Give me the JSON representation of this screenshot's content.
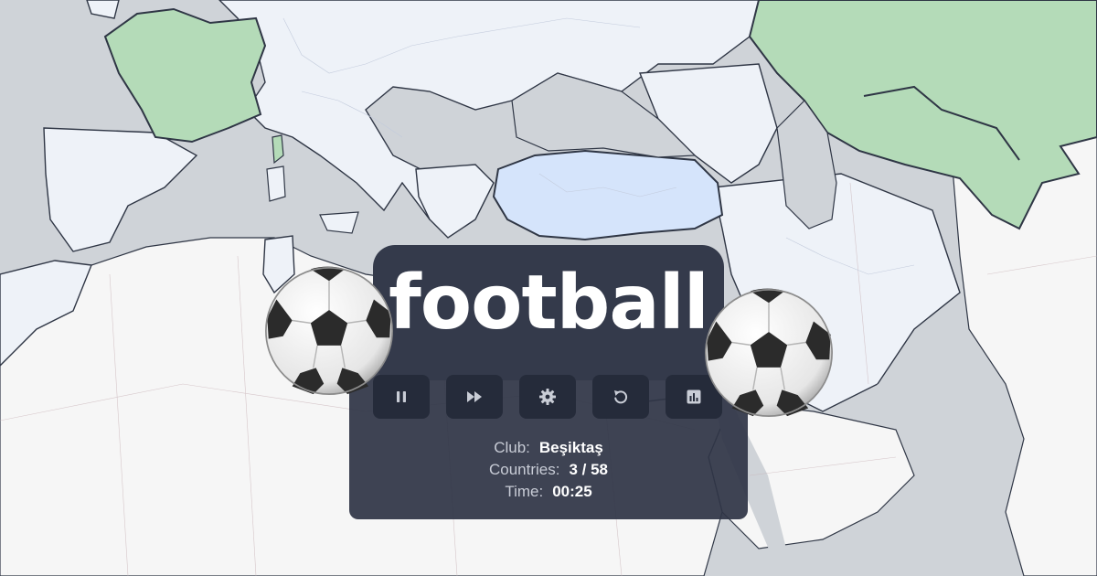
{
  "hud": {
    "topic_word": "football",
    "club_label": "Club:",
    "club_value": "Beşiktaş",
    "countries_label": "Countries:",
    "countries_value": "3 / 58",
    "time_label": "Time:",
    "time_value": "00:25"
  },
  "controls": {
    "pause_icon": "pause-icon",
    "skip_icon": "fast-forward-icon",
    "settings_icon": "gear-icon",
    "restart_icon": "restart-icon",
    "stats_icon": "bar-chart-icon"
  },
  "decor": {
    "ball_icon": "soccer-ball-icon"
  },
  "colors": {
    "sea": "#cfd3d8",
    "land": "#eef2f8",
    "land_outside": "#f6f6f6",
    "found_country": "#b4dbb8",
    "highlight_country": "#d5e4fb",
    "panel": "#343a4b",
    "button": "#252b3a"
  }
}
